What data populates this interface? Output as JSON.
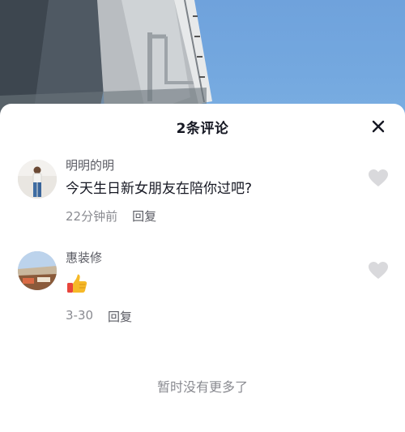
{
  "header": {
    "title": "2条评论",
    "close_icon": "close-icon"
  },
  "comments": [
    {
      "author": "明明的明",
      "text": "今天生日新女朋友在陪你过吧?",
      "time": "22分钟前",
      "reply_label": "回复",
      "avatar_icon": "person-photo-avatar",
      "like_icon": "heart-icon"
    },
    {
      "author": "惠装修",
      "text": "",
      "emoji_icon": "thumbs-up-emoji",
      "time": "3-30",
      "reply_label": "回复",
      "avatar_icon": "landscape-photo-avatar",
      "like_icon": "heart-icon"
    }
  ],
  "footer": {
    "no_more_text": "暂时没有更多了"
  },
  "colors": {
    "sky": "#74a8df",
    "sheet_bg": "#ffffff",
    "text_primary": "#161823",
    "text_secondary": "#8a8b91",
    "heart_gray": "#d9d9dc",
    "thumb_yellow": "#f6b928",
    "thumb_red": "#e8453c"
  }
}
